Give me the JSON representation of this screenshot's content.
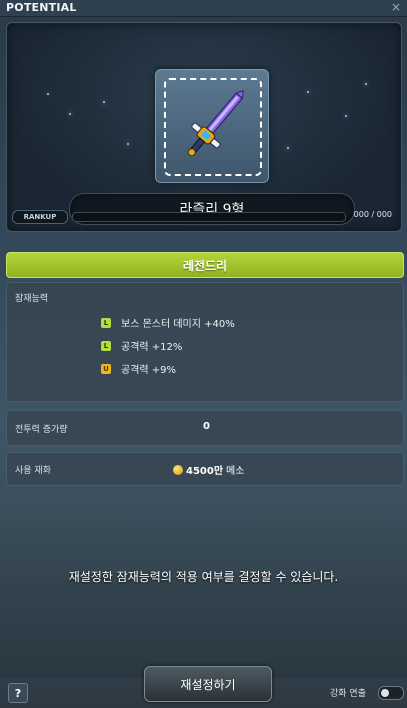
{
  "window": {
    "title": "POTENTIAL",
    "close_icon": "×"
  },
  "item": {
    "name": "라즐리 9형",
    "icon": "sword-icon"
  },
  "rankup": {
    "label": "RANKUP",
    "progress": 0,
    "count": "000 / 000"
  },
  "grade": {
    "label": "레전드리",
    "color": "#9cc22b"
  },
  "potential": {
    "label": "잠재능력",
    "lines": [
      {
        "grade": "L",
        "text": "보스 몬스터 데미지 +40%"
      },
      {
        "grade": "L",
        "text": "공격력 +12%"
      },
      {
        "grade": "U",
        "text": "공격력 +9%"
      }
    ]
  },
  "combat_power": {
    "label": "전투력 증가량",
    "value": "0"
  },
  "cost": {
    "label": "사용 재화",
    "amount": "4500만",
    "unit": "메소",
    "icon": "meso-icon"
  },
  "message": "재설정한 잠재능력의 적용 여부를 결정할 수 있습니다.",
  "buttons": {
    "reset": "재설정하기",
    "help": "?"
  },
  "effect_toggle": {
    "label": "강화 연출",
    "state": "off"
  }
}
